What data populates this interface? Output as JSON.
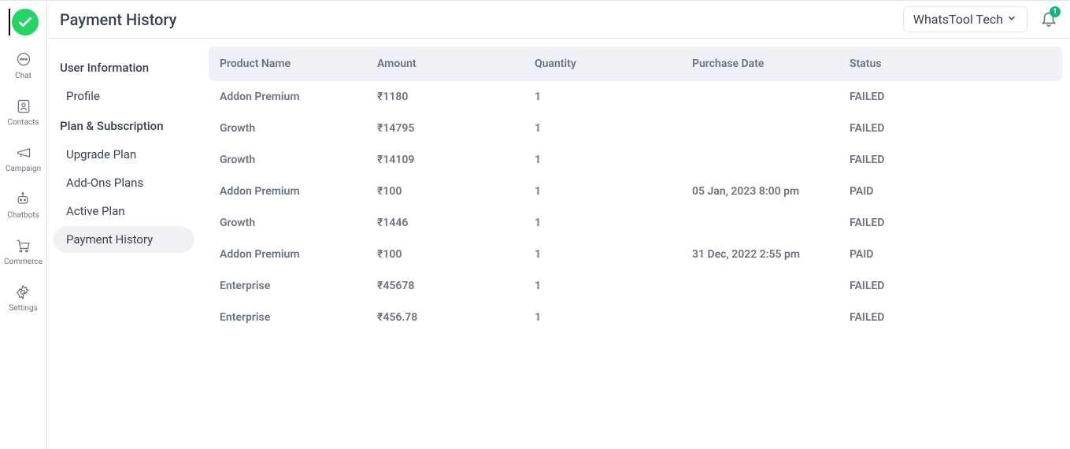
{
  "header": {
    "page_title": "Payment History",
    "workspace_label": "WhatsTool Tech",
    "notification_count": "1"
  },
  "rail": {
    "items": [
      {
        "label": "Chat",
        "icon": "chat-icon"
      },
      {
        "label": "Contacts",
        "icon": "contacts-icon"
      },
      {
        "label": "Campaign",
        "icon": "campaign-icon"
      },
      {
        "label": "Chatbots",
        "icon": "chatbots-icon"
      },
      {
        "label": "Commerce",
        "icon": "commerce-icon"
      },
      {
        "label": "Settings",
        "icon": "settings-icon"
      }
    ]
  },
  "sidebar": {
    "sections": [
      {
        "heading": "User Information",
        "items": [
          {
            "label": "Profile",
            "active": false
          }
        ]
      },
      {
        "heading": "Plan & Subscription",
        "items": [
          {
            "label": "Upgrade Plan",
            "active": false
          },
          {
            "label": "Add-Ons Plans",
            "active": false
          },
          {
            "label": "Active Plan",
            "active": false
          },
          {
            "label": "Payment History",
            "active": true
          }
        ]
      }
    ]
  },
  "table": {
    "headers": {
      "product": "Product Name",
      "amount": "Amount",
      "quantity": "Quantity",
      "date": "Purchase Date",
      "status": "Status"
    },
    "rows": [
      {
        "product": "Addon Premium",
        "amount": "₹1180",
        "quantity": "1",
        "date": "",
        "status": "FAILED"
      },
      {
        "product": "Growth",
        "amount": "₹14795",
        "quantity": "1",
        "date": "",
        "status": "FAILED"
      },
      {
        "product": "Growth",
        "amount": "₹14109",
        "quantity": "1",
        "date": "",
        "status": "FAILED"
      },
      {
        "product": "Addon Premium",
        "amount": "₹100",
        "quantity": "1",
        "date": "05 Jan, 2023 8:00 pm",
        "status": "PAID"
      },
      {
        "product": "Growth",
        "amount": "₹1446",
        "quantity": "1",
        "date": "",
        "status": "FAILED"
      },
      {
        "product": "Addon Premium",
        "amount": "₹100",
        "quantity": "1",
        "date": "31 Dec, 2022 2:55 pm",
        "status": "PAID"
      },
      {
        "product": "Enterprise",
        "amount": "₹45678",
        "quantity": "1",
        "date": "",
        "status": "FAILED"
      },
      {
        "product": "Enterprise",
        "amount": "₹456.78",
        "quantity": "1",
        "date": "",
        "status": "FAILED"
      }
    ]
  }
}
